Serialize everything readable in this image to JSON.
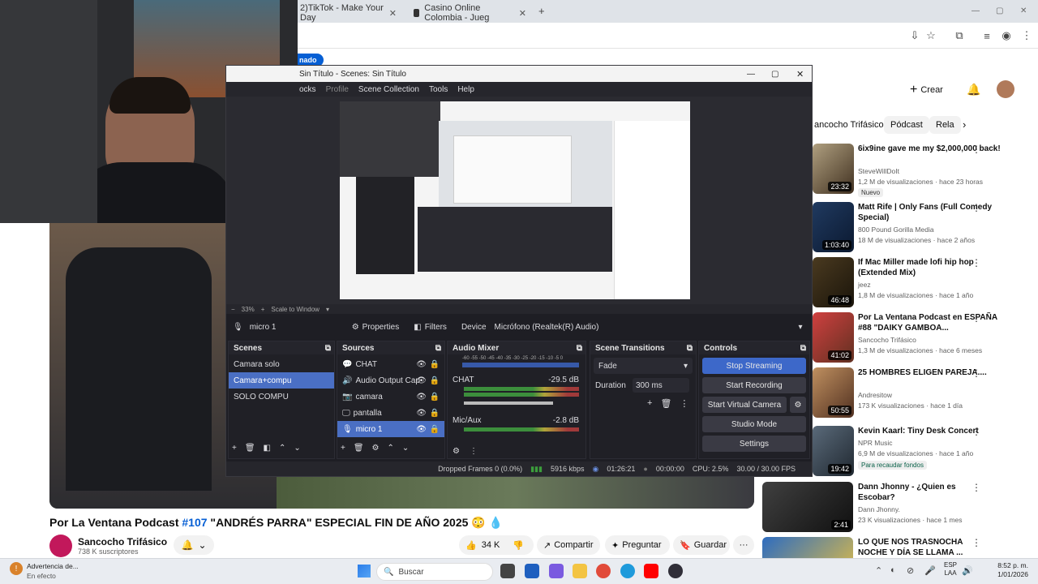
{
  "browser": {
    "tabs": [
      {
        "label": "2)TikTok - Make Your Day"
      },
      {
        "label": "Casino Online Colombia - Jueg"
      }
    ],
    "new_tab": "+",
    "window_controls": [
      "—",
      "▢",
      "✕"
    ]
  },
  "youtube": {
    "create_label": "Crear",
    "chips": [
      "ancocho Trifásico",
      "Pódcast",
      "Rela"
    ],
    "video_title_prefix": "Por La Ventana Podcast ",
    "video_title_tag": "#107",
    "video_title_rest": " \"ANDRÉS PARRA\" ESPECIAL FIN DE AÑO 2025 😳 💧",
    "channel": "Sancocho Trifásico",
    "subs": "738 K suscriptores",
    "likes": "34 K",
    "share": "Compartir",
    "ask": "Preguntar",
    "save": "Guardar",
    "more": "···",
    "notify_badge": "nado",
    "recs": [
      {
        "title": "6ix9ine gave me my $2,000,000 back!",
        "channel": "SteveWillDoIt",
        "meta": "1,2 M de visualizaciones · hace 23 horas",
        "badge": "Nuevo",
        "dur": "23:32"
      },
      {
        "title": "Matt Rife | Only Fans (Full Comedy Special)",
        "channel": "800 Pound Gorilla Media",
        "meta": "18 M de visualizaciones · hace 2 años",
        "badge": "",
        "dur": "1:03:40"
      },
      {
        "title": "If Mac Miller made lofi hip hop (Extended Mix)",
        "channel": "jeez",
        "meta": "1,8 M de visualizaciones · hace 1 año",
        "badge": "",
        "dur": "46:48"
      },
      {
        "title": "Por La Ventana Podcast en ESPAÑA #88 \"DAIKY GAMBOA...",
        "channel": "Sancocho Trifásico",
        "meta": "1,3 M de visualizaciones · hace 6 meses",
        "badge": "",
        "dur": "41:02"
      },
      {
        "title": "25 HOMBRES ELIGEN PAREJA....",
        "channel": "Andresitow",
        "meta": "173 K visualizaciones · hace 1 día",
        "badge": "",
        "dur": "50:55"
      },
      {
        "title": "Kevin Kaarl: Tiny Desk Concert",
        "channel": "NPR Music",
        "meta": "6,9 M de visualizaciones · hace 1 año",
        "badge": "Para recaudar fondos",
        "dur": "19:42"
      },
      {
        "title": "Dann Jhonny - ¿Quien es Escobar?",
        "channel": "Dann Jhonny.",
        "meta": "23 K visualizaciones · hace 1 mes",
        "badge": "",
        "dur": "2:41"
      },
      {
        "title": "LO QUE NOS TRASNOCHA NOCHE Y DÍA SE LLAMA ...",
        "channel": "",
        "meta": "",
        "badge": "",
        "dur": ""
      }
    ]
  },
  "obs": {
    "title": "Sin Título - Scenes: Sin Título",
    "menu": [
      "ocks",
      "Profile",
      "Scene Collection",
      "Tools",
      "Help"
    ],
    "zoom": "33%",
    "scale": "Scale to Window",
    "source_sel": "micro 1",
    "properties": "Properties",
    "filters": "Filters",
    "device": "Device",
    "device_value": "Micrófono (Realtek(R) Audio)",
    "scenes_hdr": "Scenes",
    "scenes": [
      "Camara solo",
      "Camara+compu",
      "SOLO COMPU"
    ],
    "sources_hdr": "Sources",
    "sources": [
      "CHAT",
      "Audio Output Cap",
      "camara",
      "pantalla",
      "micro 1"
    ],
    "mixer_hdr": "Audio Mixer",
    "mixer_scale": "-60 -55 -50 -45 -40 -35 -30 -25 -20 -15 -10 -5 0",
    "channels": [
      {
        "name": "CHAT",
        "db": "-29.5 dB"
      },
      {
        "name": "Mic/Aux",
        "db": "-2.8 dB"
      }
    ],
    "trans_hdr": "Scene Transitions",
    "transition": "Fade",
    "duration_label": "Duration",
    "duration": "300 ms",
    "controls_hdr": "Controls",
    "controls": [
      "Stop Streaming",
      "Start Recording",
      "Start Virtual Camera",
      "Studio Mode",
      "Settings"
    ],
    "status": {
      "dropped": "Dropped Frames 0 (0.0%)",
      "kbps": "5916 kbps",
      "live": "01:26:21",
      "rec": "00:00:00",
      "cpu": "CPU: 2.5%",
      "fps": "30.00 / 30.00 FPS"
    }
  },
  "taskbar": {
    "warning_title": "Advertencia de...",
    "warning_sub": "En efecto",
    "search": "Buscar",
    "lang1": "ESP",
    "lang2": "LAA",
    "time": "8:52 p. m.",
    "date": "1/01/2026"
  }
}
